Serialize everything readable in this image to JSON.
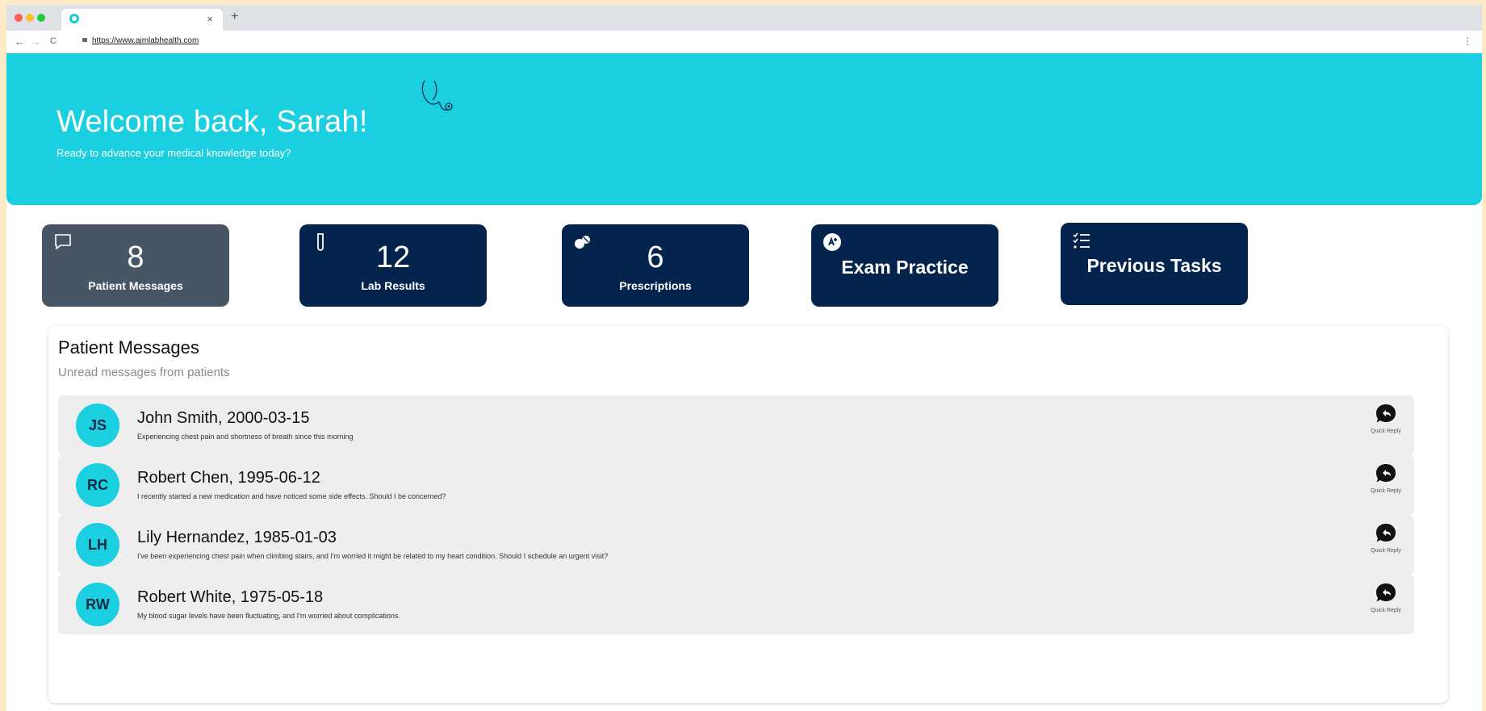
{
  "browser": {
    "url": "https://www.aimlabhealth.com",
    "tab_close": "×",
    "new_tab": "+",
    "back": "←",
    "forward": "→",
    "reload": "C",
    "menu": "⋮"
  },
  "colors": {
    "hero": "#1ad0e0",
    "card_dark": "#04244d",
    "card_active": "#485565",
    "avatar": "#1ad0e0"
  },
  "hero": {
    "title": "Welcome back, Sarah!",
    "subtitle": "Ready to advance your medical knowledge today?",
    "icon": "stethoscope-icon"
  },
  "cards": [
    {
      "number": "8",
      "label": "Patient Messages",
      "icon": "chat-bubble-icon",
      "active": true
    },
    {
      "number": "12",
      "label": "Lab Results",
      "icon": "test-tube-icon"
    },
    {
      "number": "6",
      "label": "Prescriptions",
      "icon": "pills-icon"
    },
    {
      "label": "Exam Practice",
      "icon": "exam-icon"
    },
    {
      "label": "Previous Tasks",
      "icon": "task-list-icon"
    }
  ],
  "messages": {
    "title": "Patient Messages",
    "subtitle": "Unread messages from patients",
    "reply_label": "Quick Reply",
    "items": [
      {
        "initials": "JS",
        "name": "John Smith, 2000-03-15",
        "text": "Experiencing chest pain and shortness of breath since this morning"
      },
      {
        "initials": "RC",
        "name": "Robert Chen, 1995-06-12",
        "text": "I recently started a new medication and have noticed some side effects. Should I be concerned?"
      },
      {
        "initials": "LH",
        "name": "Lily Hernandez, 1985-01-03",
        "text": "I've been experiencing chest pain when climbing stairs, and I'm worried it might be related to my heart condition. Should I schedule an urgent visit?"
      },
      {
        "initials": "RW",
        "name": "Robert White, 1975-05-18",
        "text": "My blood sugar levels have been fluctuating, and I'm worried about complications."
      }
    ]
  }
}
